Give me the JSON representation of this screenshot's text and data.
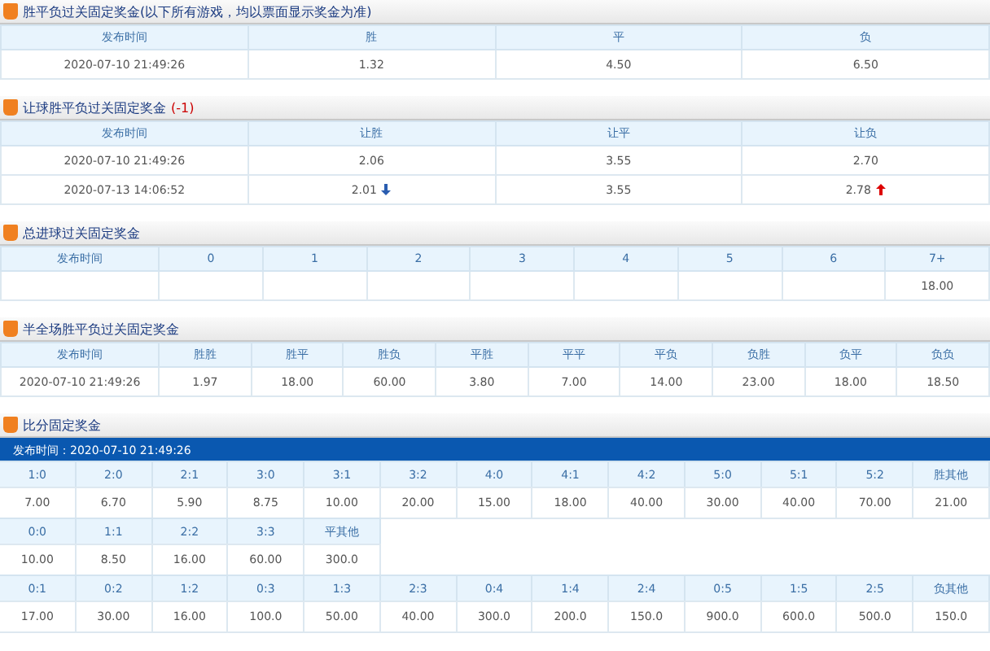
{
  "sections": [
    {
      "kind": "odds",
      "title": "胜平负过关固定奖金",
      "note": "(以下所有游戏，均以票面显示奖金为准)",
      "columns": [
        "发布时间",
        "胜",
        "平",
        "负"
      ],
      "rows": [
        {
          "time": "2020-07-10 21:49:26",
          "values": [
            {
              "text": "1.32"
            },
            {
              "text": "4.50"
            },
            {
              "text": "6.50"
            }
          ]
        }
      ]
    },
    {
      "kind": "odds",
      "title": "让球胜平负过关固定奖金",
      "handicap": "(-1)",
      "columns": [
        "发布时间",
        "让胜",
        "让平",
        "让负"
      ],
      "rows": [
        {
          "time": "2020-07-10 21:49:26",
          "values": [
            {
              "text": "2.06"
            },
            {
              "text": "3.55"
            },
            {
              "text": "2.70"
            }
          ]
        },
        {
          "time": "2020-07-13 14:06:52",
          "values": [
            {
              "text": "2.01",
              "rising": false
            },
            {
              "text": "3.55"
            },
            {
              "text": "2.78",
              "rising": true
            }
          ]
        }
      ]
    },
    {
      "kind": "odds",
      "title": "总进球过关固定奖金",
      "columns": [
        "发布时间",
        "0",
        "1",
        "2",
        "3",
        "4",
        "5",
        "6",
        "7+"
      ],
      "rows": [
        {
          "trailing": [
            {
              "text": "18.00"
            }
          ]
        }
      ]
    },
    {
      "kind": "odds",
      "title": "半全场胜平负过关固定奖金",
      "columns": [
        "发布时间",
        "胜胜",
        "胜平",
        "胜负",
        "平胜",
        "平平",
        "平负",
        "负胜",
        "负平",
        "负负"
      ],
      "rows": [
        {
          "time": "2020-07-10 21:49:26",
          "values": [
            {
              "text": "1.97"
            },
            {
              "text": "18.00"
            },
            {
              "text": "60.00"
            },
            {
              "text": "3.80"
            },
            {
              "text": "7.00"
            },
            {
              "text": "14.00"
            },
            {
              "text": "23.00"
            },
            {
              "text": "18.00"
            },
            {
              "text": "18.50"
            }
          ]
        }
      ]
    },
    {
      "kind": "scores",
      "title": "比分固定奖金",
      "published": "发布时间：2020-07-10 21:49:26",
      "groups": [
        {
          "labels": [
            "1:0",
            "2:0",
            "2:1",
            "3:0",
            "3:1",
            "3:2",
            "4:0",
            "4:1",
            "4:2",
            "5:0",
            "5:1",
            "5:2",
            "胜其他"
          ],
          "values": [
            "7.00",
            "6.70",
            "5.90",
            "8.75",
            "10.00",
            "20.00",
            "15.00",
            "18.00",
            "40.00",
            "30.00",
            "40.00",
            "70.00",
            "21.00"
          ]
        },
        {
          "labels": [
            "0:0",
            "1:1",
            "2:2",
            "3:3",
            "平其他"
          ],
          "values": [
            "10.00",
            "8.50",
            "16.00",
            "60.00",
            "300.0"
          ]
        },
        {
          "labels": [
            "0:1",
            "0:2",
            "1:2",
            "0:3",
            "1:3",
            "2:3",
            "0:4",
            "1:4",
            "2:4",
            "0:5",
            "1:5",
            "2:5",
            "负其他"
          ],
          "values": [
            "17.00",
            "30.00",
            "16.00",
            "100.0",
            "50.00",
            "40.00",
            "300.0",
            "200.0",
            "150.0",
            "900.0",
            "600.0",
            "500.0",
            "150.0"
          ]
        }
      ]
    }
  ]
}
